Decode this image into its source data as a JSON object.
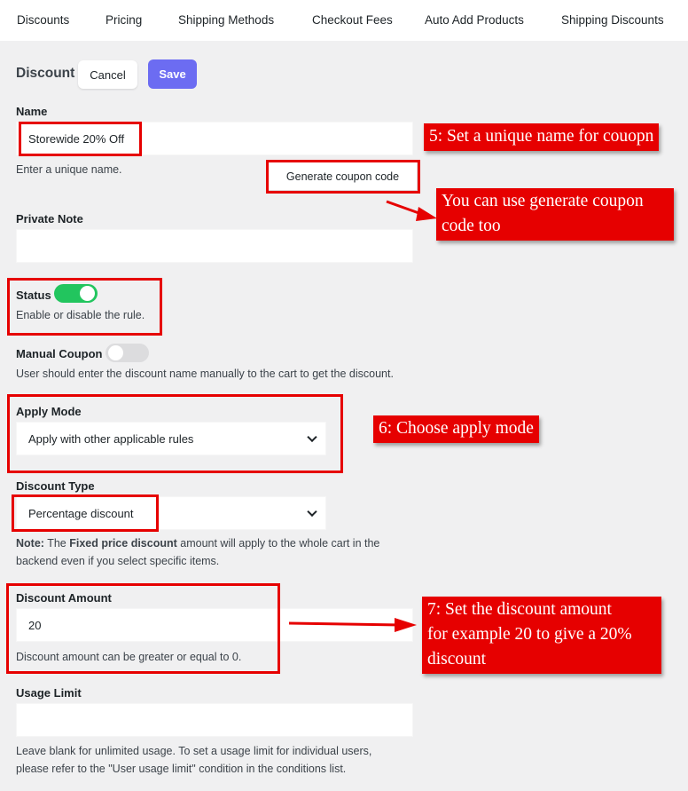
{
  "tabs": [
    "Discounts",
    "Pricing",
    "Shipping Methods",
    "Checkout Fees",
    "Auto Add Products",
    "Shipping Discounts"
  ],
  "header": {
    "title": "Discount",
    "cancel_label": "Cancel",
    "save_label": "Save"
  },
  "name_field": {
    "label": "Name",
    "value": "Storewide 20% Off",
    "help": "Enter a unique name."
  },
  "generate_button": "Generate coupon code",
  "private_note": {
    "label": "Private Note",
    "value": ""
  },
  "status": {
    "label": "Status",
    "help": "Enable or disable the rule.",
    "enabled": true
  },
  "manual_coupon": {
    "label": "Manual Coupon",
    "help": "User should enter the discount name manually to the cart to get the discount.",
    "enabled": false
  },
  "apply_mode": {
    "label": "Apply Mode",
    "selected": "Apply with other applicable rules"
  },
  "discount_type": {
    "label": "Discount Type",
    "selected": "Percentage discount"
  },
  "note": {
    "prefix": "Note:",
    "part1": " The ",
    "bold": "Fixed price discount",
    "part2": " amount will apply to the whole cart in the",
    "line2": "backend even if you select specific items."
  },
  "discount_amount": {
    "label": "Discount Amount",
    "value": "20",
    "help": "Discount amount can be greater or equal to 0."
  },
  "usage_limit": {
    "label": "Usage Limit",
    "value": "",
    "help_line1": "Leave blank for unlimited usage. To set a usage limit for individual users,",
    "help_line2": "please refer to the \"User usage limit\" condition in the conditions list."
  },
  "annotations": {
    "name": "5: Set a unique name for couopn",
    "generate_line1": "You can use generate coupon",
    "generate_line2": "code too",
    "apply_mode": "6: Choose apply mode",
    "amount_line1": "7: Set the discount amount",
    "amount_line2": "for example 20 to give a 20%",
    "amount_line3": "discount"
  },
  "colors": {
    "accent": "#6c6cf2",
    "toggle_on": "#22c55e",
    "toggle_off": "#dcdcde",
    "annotation_red": "#e60000",
    "background": "#f0f0f1"
  }
}
